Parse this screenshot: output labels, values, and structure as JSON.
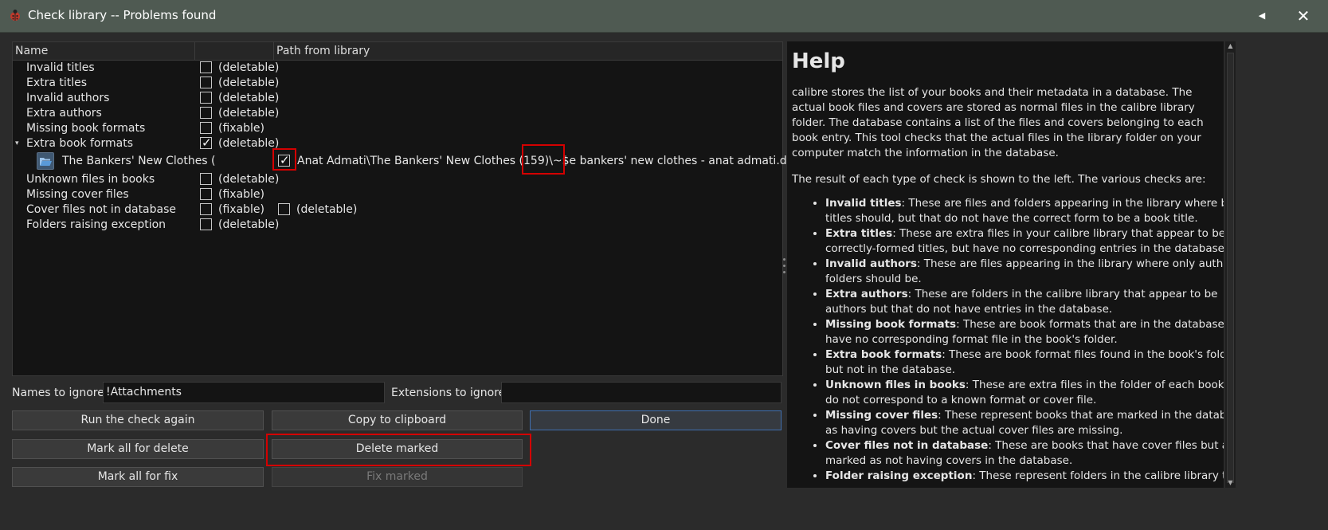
{
  "window": {
    "title": "Check library -- Problems found",
    "icon": "calibre-ladybug-icon",
    "back_glyph": "◀",
    "close_glyph": "✕"
  },
  "tree": {
    "headers": [
      "Name",
      "",
      "Path from library"
    ],
    "rows": [
      {
        "name": "Invalid titles",
        "state": "(deletable)",
        "checked": false
      },
      {
        "name": "Extra titles",
        "state": "(deletable)",
        "checked": false
      },
      {
        "name": "Invalid authors",
        "state": "(deletable)",
        "checked": false
      },
      {
        "name": "Extra authors",
        "state": "(deletable)",
        "checked": false
      },
      {
        "name": "Missing book formats",
        "state": "(fixable)",
        "checked": false
      },
      {
        "name": "Extra book formats",
        "state": "(deletable)",
        "checked": true,
        "expanded": true
      },
      {
        "name": "Unknown files in books",
        "state": "(deletable)",
        "checked": false
      },
      {
        "name": "Missing cover files",
        "state": "(fixable)",
        "checked": false
      },
      {
        "name": "Cover files not in database",
        "state": "(fixable)",
        "checked": false,
        "state2": "(deletable)"
      },
      {
        "name": "Folders raising exception",
        "state": "(deletable)",
        "checked": false
      }
    ],
    "child": {
      "name": "The Bankers' New Clothes (",
      "path": "Anat Admati\\The Bankers' New Clothes (159)\\~$e bankers' new clothes - anat admati.docx",
      "checked": true,
      "icon": "folder-open-icon"
    },
    "expander_glyph": "▾"
  },
  "ignore": {
    "names_label": "Names to ignore:",
    "names_value": "!Attachments",
    "extensions_label": "Extensions to ignore:",
    "extensions_value": ""
  },
  "buttons": {
    "run_again": "Run the check again",
    "copy_clipboard": "Copy to clipboard",
    "done": "Done",
    "mark_delete": "Mark all for delete",
    "delete_marked": "Delete marked",
    "mark_fix": "Mark all for fix",
    "fix_marked": "Fix marked"
  },
  "help": {
    "title": "Help",
    "p1": "calibre stores the list of your books and their metadata in a database. The actual book files and covers are stored as normal files in the calibre library folder. The database contains a list of the files and covers belonging to each book entry. This tool checks that the actual files in the library folder on your computer match the information in the database.",
    "p2": "The result of each type of check is shown to the left. The various checks are:",
    "items": [
      {
        "term": "Invalid titles",
        "desc": ": These are files and folders appearing in the library where books titles should, but that do not have the correct form to be a book title."
      },
      {
        "term": "Extra titles",
        "desc": ": These are extra files in your calibre library that appear to be correctly-formed titles, but have no corresponding entries in the database."
      },
      {
        "term": "Invalid authors",
        "desc": ": These are files appearing in the library where only author folders should be."
      },
      {
        "term": "Extra authors",
        "desc": ": These are folders in the calibre library that appear to be authors but that do not have entries in the database."
      },
      {
        "term": "Missing book formats",
        "desc": ": These are book formats that are in the database but have no corresponding format file in the book's folder."
      },
      {
        "term": "Extra book formats",
        "desc": ": These are book format files found in the book's folder but not in the database."
      },
      {
        "term": "Unknown files in books",
        "desc": ": These are extra files in the folder of each book that do not correspond to a known format or cover file."
      },
      {
        "term": "Missing cover files",
        "desc": ": These represent books that are marked in the database as having covers but the actual cover files are missing."
      },
      {
        "term": "Cover files not in database",
        "desc": ": These are books that have cover files but are marked as not having covers in the database."
      },
      {
        "term": "Folder raising exception",
        "desc": ": These represent folders in the calibre library that"
      }
    ]
  },
  "colors": {
    "titlebar": "#4f5a52",
    "highlight_box": "#d40000",
    "default_button_border": "#3f6fb0"
  }
}
